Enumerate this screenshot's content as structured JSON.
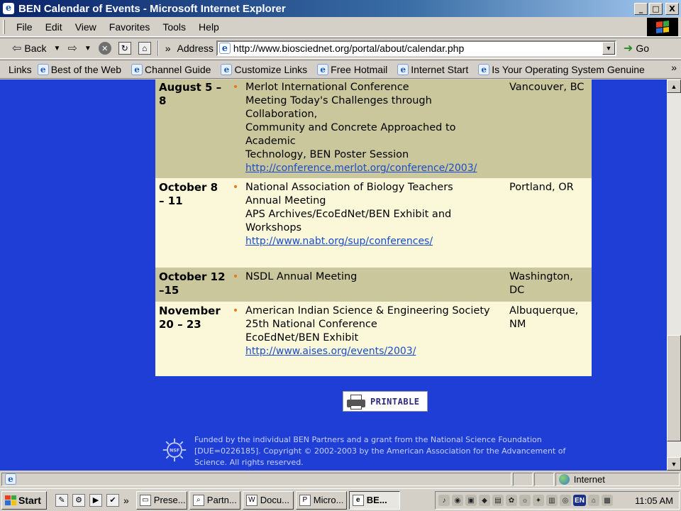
{
  "window": {
    "title": "BEN Calendar of Events - Microsoft Internet Explorer",
    "minimize": "_",
    "maximize": "□",
    "close": "X"
  },
  "menu": [
    "File",
    "Edit",
    "View",
    "Favorites",
    "Tools",
    "Help"
  ],
  "toolbar": {
    "back_label": "Back",
    "more": "»",
    "address_label": "Address",
    "url": "http://www.biosciednet.org/portal/about/calendar.php",
    "go_label": "Go"
  },
  "links": {
    "label": "Links",
    "items": [
      "Best of the Web",
      "Channel Guide",
      "Customize Links",
      "Free Hotmail",
      "Internet Start",
      "Is Your Operating System Genuine"
    ],
    "more": "»"
  },
  "events": [
    {
      "date": "August 5 – 8",
      "lines": [
        "Merlot International Conference",
        "Meeting Today's Challenges through Collaboration,",
        "Community and Concrete Approached to Academic",
        "Technology, BEN Poster Session"
      ],
      "link": "http://conference.merlot.org/conference/2003/",
      "location": "Vancouver, BC"
    },
    {
      "date": "October 8 – 11",
      "lines": [
        "National Association of Biology Teachers",
        "Annual Meeting",
        "APS Archives/EcoEdNet/BEN Exhibit and Workshops"
      ],
      "link": "http://www.nabt.org/sup/conferences/",
      "location": "Portland, OR"
    },
    {
      "date": "October 12 –15",
      "lines": [
        "NSDL Annual Meeting"
      ],
      "link": "",
      "location": "Washington, DC"
    },
    {
      "date": "November 20 – 23",
      "lines": [
        "American Indian Science & Engineering Society",
        "25th National Conference",
        "EcoEdNet/BEN Exhibit"
      ],
      "link": "http://www.aises.org/events/2003/",
      "location": "Albuquerque, NM"
    }
  ],
  "printable_label": "PRINTABLE",
  "footer_text": "Funded by the individual BEN Partners and a grant from the National Science Foundation [DUE=0226185]. Copyright © 2002-2003 by the American Association for the Advancement of Science. All rights reserved.",
  "status": {
    "zone": "Internet"
  },
  "taskbar": {
    "start": "Start",
    "quick_more": "»",
    "tasks": [
      "Prese...",
      "Partn...",
      "Docu...",
      "Micro...",
      "BE..."
    ],
    "tray_lang": "EN",
    "clock": "11:05 AM"
  },
  "colors": {
    "page_bg": "#1e3ed6",
    "row_dark": "#cbc79c",
    "row_light": "#fbf8da",
    "bullet": "#e67a1e",
    "link": "#1a4cc9"
  }
}
